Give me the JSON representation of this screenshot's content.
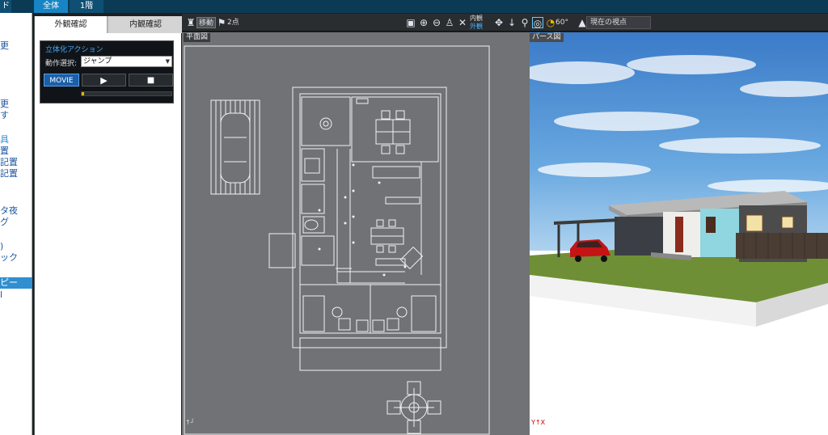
{
  "topbar": {
    "left_tab": "ド",
    "tab_all": "全体",
    "tab_floor": "1階"
  },
  "sidebar": {
    "items": [
      "更",
      "更",
      "す",
      "具",
      "置",
      "記置",
      "記置",
      "タ夜",
      "グ",
      ")",
      "ック",
      "ピー",
      "l"
    ]
  },
  "panel": {
    "tab_exterior": "外観確認",
    "tab_interior": "内観確認",
    "action_title": "立体化アクション",
    "select_label": "動作選択:",
    "select_value": "ジャンプ",
    "movie_label": "MOVIE",
    "play_icon": "play-icon",
    "stop_icon": "stop-icon",
    "progress": 0.03
  },
  "toolbar": {
    "move_label": "移動",
    "two_point_label": "2点",
    "interior_label": "内観",
    "exterior_label": "外観",
    "angle_label": "60°",
    "viewpoint_label": "現在の視点"
  },
  "views": {
    "plan_label": "平面図",
    "persp_label": "パース図"
  },
  "colors": {
    "accent": "#1785c4",
    "plan_bg": "#707275",
    "sky": "#4f8fd6",
    "wall_blue": "#8fd6e0"
  }
}
